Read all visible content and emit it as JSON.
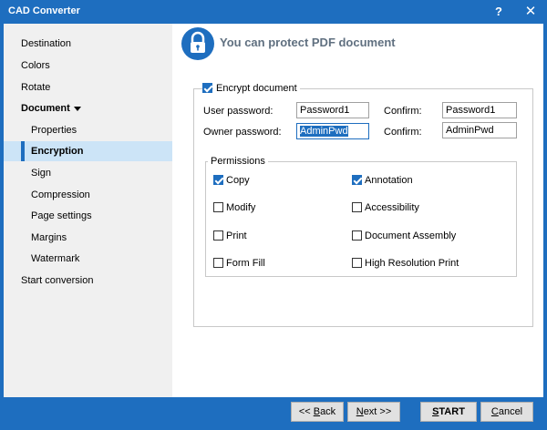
{
  "window": {
    "title": "CAD Converter",
    "help_label": "?",
    "close_label": "✕"
  },
  "sidebar": {
    "items": [
      {
        "label": "Destination"
      },
      {
        "label": "Colors"
      },
      {
        "label": "Rotate"
      },
      {
        "label": "Document"
      },
      {
        "label": "Properties"
      },
      {
        "label": "Encryption"
      },
      {
        "label": "Sign"
      },
      {
        "label": "Compression"
      },
      {
        "label": "Page settings"
      },
      {
        "label": "Margins"
      },
      {
        "label": "Watermark"
      },
      {
        "label": "Start conversion"
      }
    ]
  },
  "header": {
    "title": "You can protect PDF document"
  },
  "encrypt": {
    "label": "Encrypt document",
    "checked": true,
    "user_password_label": "User password:",
    "user_password_value": "Password1",
    "owner_password_label": "Owner password:",
    "owner_password_value": "AdminPwd",
    "confirm_label": "Confirm:",
    "confirm_user_value": "Password1",
    "confirm_owner_value": "AdminPwd"
  },
  "permissions": {
    "label": "Permissions",
    "items": [
      {
        "label": "Copy",
        "checked": true
      },
      {
        "label": "Annotation",
        "checked": true
      },
      {
        "label": "Modify",
        "checked": false
      },
      {
        "label": "Accessibility",
        "checked": false
      },
      {
        "label": "Print",
        "checked": false
      },
      {
        "label": "Document Assembly",
        "checked": false
      },
      {
        "label": "Form Fill",
        "checked": false
      },
      {
        "label": "High Resolution Print",
        "checked": false
      }
    ]
  },
  "buttons": {
    "back_prefix": "<< ",
    "back_accel": "B",
    "back_suffix": "ack",
    "next_accel": "N",
    "next_suffix": "ext >>",
    "start_accel": "S",
    "start_suffix": "TART",
    "cancel_accel": "C",
    "cancel_suffix": "ancel"
  },
  "colors": {
    "accent": "#1e6ebf",
    "active_item": "#cce4f7"
  },
  "icons": {
    "lock": "lock-icon",
    "help": "help-icon",
    "close": "close-icon",
    "caret": "caret-down-icon"
  }
}
